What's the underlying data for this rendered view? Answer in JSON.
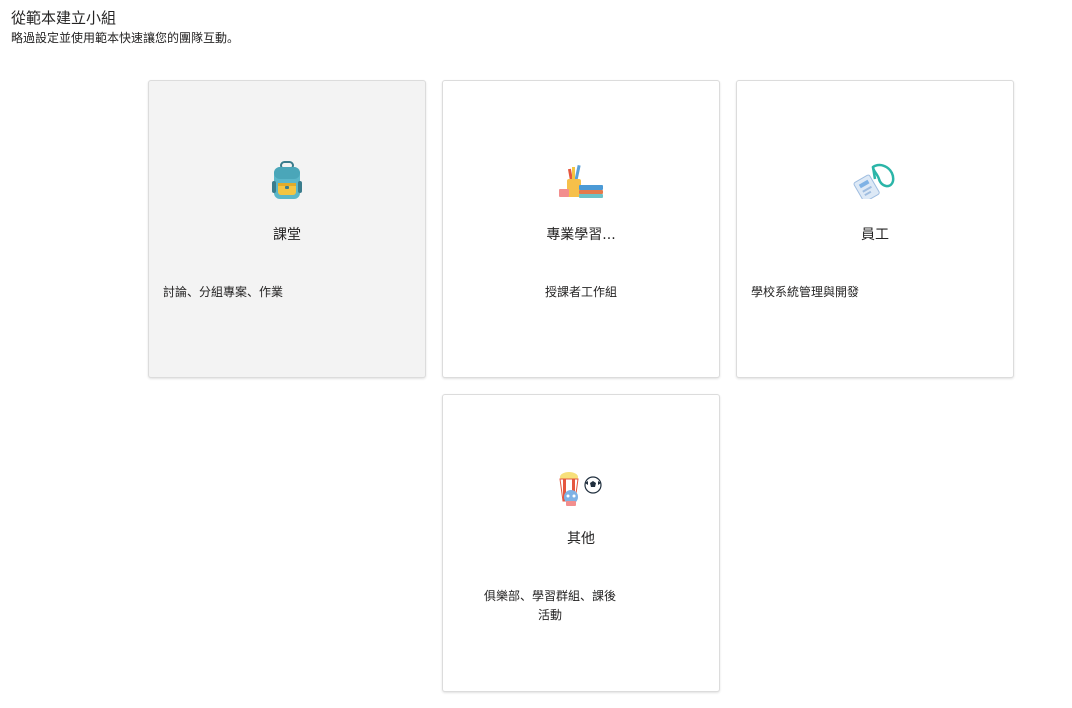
{
  "header": {
    "title": "從範本建立小組",
    "subtitle": "略過設定並使用範本快速讓您的團隊互動。"
  },
  "cards": [
    {
      "title": "課堂",
      "description": "討論、分組專案、作業",
      "icon": "backpack-icon"
    },
    {
      "title": "專業學習...",
      "description": "授課者工作組",
      "icon": "books-pencils-icon"
    },
    {
      "title": "員工",
      "description": "學校系統管理與開發",
      "icon": "lanyard-badge-icon"
    },
    {
      "title": "其他",
      "description": "俱樂部、學習群組、課後活動",
      "icon": "popcorn-soccer-icon"
    }
  ]
}
